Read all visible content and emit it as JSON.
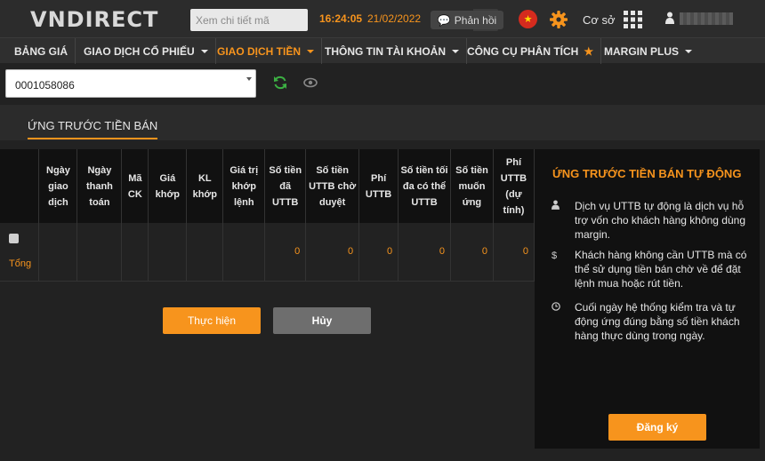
{
  "header": {
    "logo": "VNDIRECT",
    "search_placeholder": "Xem chi tiết mã",
    "time": "16:24:05",
    "date": "21/02/2022",
    "feedback_label": "Phản hồi",
    "mode_label": "Cơ sở",
    "accent_color": "#f7941d"
  },
  "nav": {
    "items": [
      {
        "label": "BẢNG GIÁ"
      },
      {
        "label": "GIAO DỊCH CỔ PHIẾU"
      },
      {
        "label": "GIAO DỊCH TIỀN"
      },
      {
        "label": "THÔNG TIN TÀI KHOẢN"
      },
      {
        "label": "CÔNG CỤ PHÂN TÍCH"
      },
      {
        "label": "MARGIN PLUS"
      }
    ]
  },
  "account": {
    "selected": "0001058086"
  },
  "page": {
    "tab_label": "ỨNG TRƯỚC TIỀN BÁN"
  },
  "table": {
    "headers": [
      "",
      "Ngày giao dịch",
      "Ngày thanh toán",
      "Mã CK",
      "Giá khớp",
      "KL khớp",
      "Giá trị khớp lệnh",
      "Số tiền đã UTTB",
      "Số tiền UTTB chờ duyệt",
      "Phí UTTB",
      "Số tiền tối đa có thể UTTB",
      "Số tiền muốn ứng",
      "Phí UTTB (dự tính)"
    ],
    "total_label": "Tổng",
    "totals": [
      "0",
      "0",
      "0",
      "0",
      "0",
      "0"
    ]
  },
  "actions": {
    "execute_label": "Thực hiện",
    "cancel_label": "Hủy"
  },
  "panel": {
    "title": "ỨNG TRƯỚC TIỀN BÁN TỰ ĐỘNG",
    "items": [
      {
        "icon": "user-icon",
        "text": "Dịch vụ UTTB tự động là dịch vụ hỗ trợ vốn cho khách hàng không dùng margin."
      },
      {
        "icon": "dollar-icon",
        "text": "Khách hàng không cần UTTB mà có thể sử dụng tiền bán chờ về để đặt lệnh mua hoặc rút tiền."
      },
      {
        "icon": "clock-icon",
        "text": "Cuối ngày hệ thống kiểm tra và tự động ứng đúng bằng số tiền khách hàng thực dùng trong ngày."
      }
    ],
    "register_label": "Đăng ký"
  }
}
